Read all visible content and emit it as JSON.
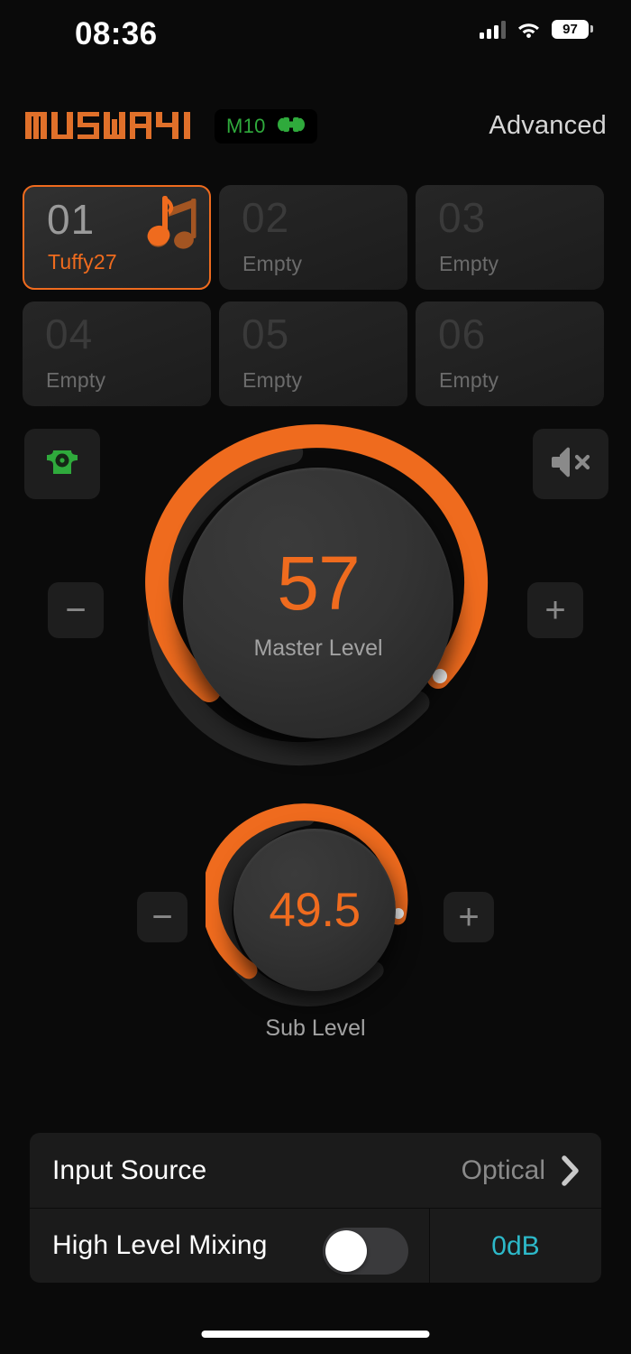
{
  "status_bar": {
    "time": "08:36",
    "battery_percent": "97",
    "signal_icon": "cellular-signal-icon",
    "wifi_icon": "wifi-icon",
    "battery_icon": "battery-icon"
  },
  "header": {
    "brand": "MUSWAY",
    "device_badge": {
      "label": "M10",
      "icon": "plug-connector-icon",
      "color": "#2faa3c"
    },
    "advanced_label": "Advanced"
  },
  "presets": {
    "items": [
      {
        "number": "01",
        "label": "Tuffy27",
        "active": true,
        "icon": "music-note-icon"
      },
      {
        "number": "02",
        "label": "Empty",
        "active": false,
        "icon": ""
      },
      {
        "number": "03",
        "label": "Empty",
        "active": false,
        "icon": ""
      },
      {
        "number": "04",
        "label": "Empty",
        "active": false,
        "icon": ""
      },
      {
        "number": "05",
        "label": "Empty",
        "active": false,
        "icon": ""
      },
      {
        "number": "06",
        "label": "Empty",
        "active": false,
        "icon": ""
      }
    ]
  },
  "master": {
    "value": "57",
    "caption": "Master Level",
    "minus_label": "−",
    "plus_label": "+",
    "output_icon": "subwoofer-output-icon",
    "mute_icon": "speaker-mute-icon",
    "arc_percent": 57
  },
  "sub": {
    "value": "49.5",
    "caption": "Sub Level",
    "minus_label": "−",
    "plus_label": "+",
    "arc_percent": 49.5
  },
  "settings": {
    "rows": [
      {
        "label": "Input Source",
        "value": "Optical",
        "chevron_icon": "chevron-right-icon"
      },
      {
        "label": "High Level Mixing",
        "toggle_state": "off",
        "db_value": "0dB"
      }
    ]
  },
  "colors": {
    "accent_orange": "#ef6b1e",
    "accent_cyan": "#2db9c9",
    "accent_green": "#2faa3c",
    "background": "#0a0a0a"
  }
}
